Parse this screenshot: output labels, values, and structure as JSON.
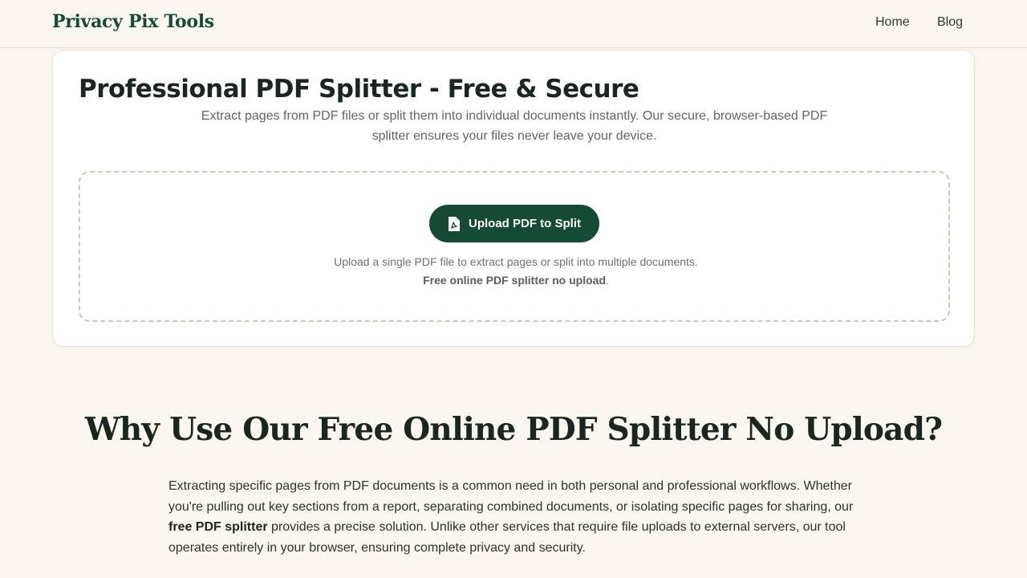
{
  "nav": {
    "brand": "Privacy Pix Tools",
    "links": [
      {
        "label": "Home"
      },
      {
        "label": "Blog"
      }
    ]
  },
  "hero": {
    "title": "Professional PDF Splitter - Free & Secure",
    "description": "Extract pages from PDF files or split them into individual documents instantly. Our secure, browser-based PDF splitter ensures your files never leave your device.",
    "upload_button": "Upload PDF to Split",
    "upload_icon": "pdf-file-icon",
    "hint_text": "Upload a single PDF file to extract pages or split into multiple documents.",
    "hint_bold": "Free online PDF splitter no upload",
    "hint_end": "."
  },
  "section": {
    "title": "Why Use Our Free Online PDF Splitter No Upload?",
    "p1_start": "Extracting specific pages from PDF documents is a common need in both personal and professional workflows. Whether you're pulling out key sections from a report, separating combined documents, or isolating specific pages for sharing, our",
    "p1_bold": "free PDF splitter",
    "p1_end": "provides a precise solution. Unlike other services that require file uploads to external servers, our tool operates entirely in your browser, ensuring complete privacy and security."
  },
  "colors": {
    "background": "#faf7f1",
    "brand": "#154a35",
    "button": "#154a35",
    "card": "#ffffff"
  }
}
